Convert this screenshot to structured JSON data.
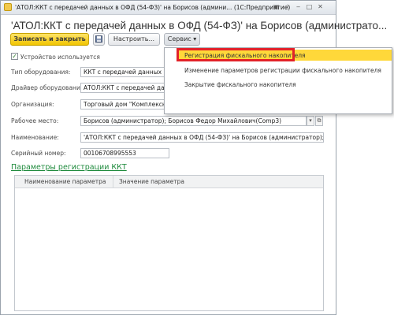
{
  "window": {
    "title": "'АТОЛ:ККТ с передачей данных в ОФД (54-ФЗ)' на Борисов (админи... (1С:Предприятие)"
  },
  "form": {
    "title": "'АТОЛ:ККТ с передачей данных в ОФД (54-ФЗ)' на Борисов (администрато..."
  },
  "toolbar": {
    "save_close": "Записать и закрыть",
    "settings": "Настроить...",
    "service": "Сервис"
  },
  "device_used": {
    "label": "Устройство используется",
    "checked": true
  },
  "fields": {
    "equipment_type": {
      "label": "Тип оборудования:",
      "value": "ККТ с передачей данных"
    },
    "driver": {
      "label": "Драйвер оборудования:",
      "value": "АТОЛ:ККТ с передачей дан"
    },
    "organization": {
      "label": "Организация:",
      "value": "Торговый дом \"Комплексный\""
    },
    "workplace": {
      "label": "Рабочее место:",
      "value": "Борисов (администратор); Борисов Федор Михайлович(Comp3)"
    },
    "name": {
      "label": "Наименование:",
      "value": "'АТОЛ:ККТ с передачей данных в ОФД (54-ФЗ)' на Борисов (администратор); Борис"
    },
    "serial": {
      "label": "Серийный номер:",
      "value": "00106708995553"
    }
  },
  "registration_link": "Параметры регистрации ККТ",
  "table": {
    "columns": [
      "Наименование параметра",
      "Значение параметра"
    ]
  },
  "service_menu": {
    "items": [
      "Регистрация фискального накопителя",
      "Изменение параметров регистрации фискального накопителя",
      "Закрытие фискального накопителя"
    ],
    "selected_index": 0
  },
  "colors": {
    "accent_yellow": "#f1c400",
    "link_green": "#1e8a3c",
    "highlight_red": "#e32229",
    "menu_selected": "#ffd83a"
  }
}
